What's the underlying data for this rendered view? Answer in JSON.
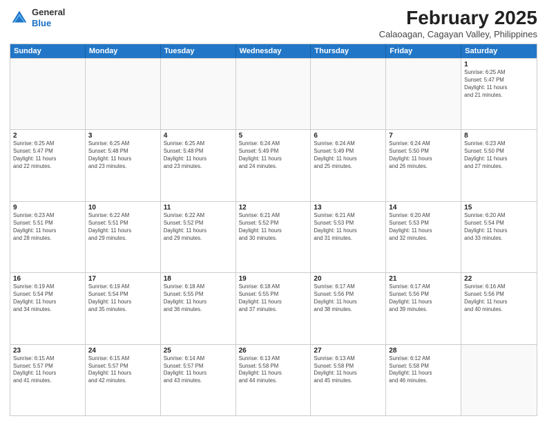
{
  "header": {
    "logo_line1": "General",
    "logo_line2": "Blue",
    "month_title": "February 2025",
    "location": "Calaoagan, Cagayan Valley, Philippines"
  },
  "weekdays": [
    "Sunday",
    "Monday",
    "Tuesday",
    "Wednesday",
    "Thursday",
    "Friday",
    "Saturday"
  ],
  "rows": [
    [
      {
        "day": "",
        "info": ""
      },
      {
        "day": "",
        "info": ""
      },
      {
        "day": "",
        "info": ""
      },
      {
        "day": "",
        "info": ""
      },
      {
        "day": "",
        "info": ""
      },
      {
        "day": "",
        "info": ""
      },
      {
        "day": "1",
        "info": "Sunrise: 6:25 AM\nSunset: 5:47 PM\nDaylight: 11 hours\nand 21 minutes."
      }
    ],
    [
      {
        "day": "2",
        "info": "Sunrise: 6:25 AM\nSunset: 5:47 PM\nDaylight: 11 hours\nand 22 minutes."
      },
      {
        "day": "3",
        "info": "Sunrise: 6:25 AM\nSunset: 5:48 PM\nDaylight: 11 hours\nand 23 minutes."
      },
      {
        "day": "4",
        "info": "Sunrise: 6:25 AM\nSunset: 5:48 PM\nDaylight: 11 hours\nand 23 minutes."
      },
      {
        "day": "5",
        "info": "Sunrise: 6:24 AM\nSunset: 5:49 PM\nDaylight: 11 hours\nand 24 minutes."
      },
      {
        "day": "6",
        "info": "Sunrise: 6:24 AM\nSunset: 5:49 PM\nDaylight: 11 hours\nand 25 minutes."
      },
      {
        "day": "7",
        "info": "Sunrise: 6:24 AM\nSunset: 5:50 PM\nDaylight: 11 hours\nand 26 minutes."
      },
      {
        "day": "8",
        "info": "Sunrise: 6:23 AM\nSunset: 5:50 PM\nDaylight: 11 hours\nand 27 minutes."
      }
    ],
    [
      {
        "day": "9",
        "info": "Sunrise: 6:23 AM\nSunset: 5:51 PM\nDaylight: 11 hours\nand 28 minutes."
      },
      {
        "day": "10",
        "info": "Sunrise: 6:22 AM\nSunset: 5:51 PM\nDaylight: 11 hours\nand 29 minutes."
      },
      {
        "day": "11",
        "info": "Sunrise: 6:22 AM\nSunset: 5:52 PM\nDaylight: 11 hours\nand 29 minutes."
      },
      {
        "day": "12",
        "info": "Sunrise: 6:21 AM\nSunset: 5:52 PM\nDaylight: 11 hours\nand 30 minutes."
      },
      {
        "day": "13",
        "info": "Sunrise: 6:21 AM\nSunset: 5:53 PM\nDaylight: 11 hours\nand 31 minutes."
      },
      {
        "day": "14",
        "info": "Sunrise: 6:20 AM\nSunset: 5:53 PM\nDaylight: 11 hours\nand 32 minutes."
      },
      {
        "day": "15",
        "info": "Sunrise: 6:20 AM\nSunset: 5:54 PM\nDaylight: 11 hours\nand 33 minutes."
      }
    ],
    [
      {
        "day": "16",
        "info": "Sunrise: 6:19 AM\nSunset: 5:54 PM\nDaylight: 11 hours\nand 34 minutes."
      },
      {
        "day": "17",
        "info": "Sunrise: 6:19 AM\nSunset: 5:54 PM\nDaylight: 11 hours\nand 35 minutes."
      },
      {
        "day": "18",
        "info": "Sunrise: 6:18 AM\nSunset: 5:55 PM\nDaylight: 11 hours\nand 36 minutes."
      },
      {
        "day": "19",
        "info": "Sunrise: 6:18 AM\nSunset: 5:55 PM\nDaylight: 11 hours\nand 37 minutes."
      },
      {
        "day": "20",
        "info": "Sunrise: 6:17 AM\nSunset: 5:56 PM\nDaylight: 11 hours\nand 38 minutes."
      },
      {
        "day": "21",
        "info": "Sunrise: 6:17 AM\nSunset: 5:56 PM\nDaylight: 11 hours\nand 39 minutes."
      },
      {
        "day": "22",
        "info": "Sunrise: 6:16 AM\nSunset: 5:56 PM\nDaylight: 11 hours\nand 40 minutes."
      }
    ],
    [
      {
        "day": "23",
        "info": "Sunrise: 6:15 AM\nSunset: 5:57 PM\nDaylight: 11 hours\nand 41 minutes."
      },
      {
        "day": "24",
        "info": "Sunrise: 6:15 AM\nSunset: 5:57 PM\nDaylight: 11 hours\nand 42 minutes."
      },
      {
        "day": "25",
        "info": "Sunrise: 6:14 AM\nSunset: 5:57 PM\nDaylight: 11 hours\nand 43 minutes."
      },
      {
        "day": "26",
        "info": "Sunrise: 6:13 AM\nSunset: 5:58 PM\nDaylight: 11 hours\nand 44 minutes."
      },
      {
        "day": "27",
        "info": "Sunrise: 6:13 AM\nSunset: 5:58 PM\nDaylight: 11 hours\nand 45 minutes."
      },
      {
        "day": "28",
        "info": "Sunrise: 6:12 AM\nSunset: 5:58 PM\nDaylight: 11 hours\nand 46 minutes."
      },
      {
        "day": "",
        "info": ""
      }
    ]
  ]
}
